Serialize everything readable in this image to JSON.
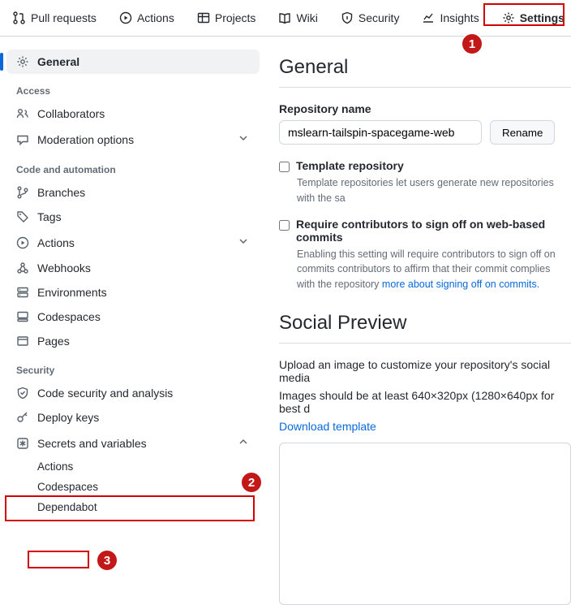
{
  "topnav": [
    {
      "label": "Pull requests",
      "icon": "git-pull-icon"
    },
    {
      "label": "Actions",
      "icon": "play-circle-icon"
    },
    {
      "label": "Projects",
      "icon": "table-icon"
    },
    {
      "label": "Wiki",
      "icon": "book-icon"
    },
    {
      "label": "Security",
      "icon": "shield-icon"
    },
    {
      "label": "Insights",
      "icon": "graph-icon"
    },
    {
      "label": "Settings",
      "icon": "gear-icon"
    }
  ],
  "sidebar": {
    "general": {
      "label": "General"
    },
    "groups": [
      {
        "title": "Access",
        "items": [
          {
            "label": "Collaborators",
            "icon": "people-icon"
          },
          {
            "label": "Moderation options",
            "icon": "comment-icon",
            "expandable": true
          }
        ]
      },
      {
        "title": "Code and automation",
        "items": [
          {
            "label": "Branches",
            "icon": "branch-icon"
          },
          {
            "label": "Tags",
            "icon": "tag-icon"
          },
          {
            "label": "Actions",
            "icon": "play-circle-icon",
            "expandable": true
          },
          {
            "label": "Webhooks",
            "icon": "webhook-icon"
          },
          {
            "label": "Environments",
            "icon": "server-icon"
          },
          {
            "label": "Codespaces",
            "icon": "codespaces-icon"
          },
          {
            "label": "Pages",
            "icon": "browser-icon"
          }
        ]
      },
      {
        "title": "Security",
        "items": [
          {
            "label": "Code security and analysis",
            "icon": "shield-check-icon"
          },
          {
            "label": "Deploy keys",
            "icon": "key-icon"
          },
          {
            "label": "Secrets and variables",
            "icon": "asterisk-icon",
            "expandable": true,
            "expanded": true,
            "subitems": [
              {
                "label": "Actions"
              },
              {
                "label": "Codespaces"
              },
              {
                "label": "Dependabot"
              }
            ]
          }
        ]
      }
    ]
  },
  "content": {
    "general_title": "General",
    "repo_name_label": "Repository name",
    "repo_name_value": "mslearn-tailspin-spacegame-web",
    "rename_btn": "Rename",
    "template_label": "Template repository",
    "template_desc": "Template repositories let users generate new repositories with the sa",
    "signoff_label": "Require contributors to sign off on web-based commits",
    "signoff_desc": "Enabling this setting will require contributors to sign off on commits contributors to affirm that their commit complies with the repository ",
    "signoff_link": "more about signing off on commits.",
    "social_title": "Social Preview",
    "social_desc": "Upload an image to customize your repository's social media",
    "social_dims": "Images should be at least 640×320px (1280×640px for best d",
    "download_template": "Download template"
  },
  "annotations": {
    "b1": "1",
    "b2": "2",
    "b3": "3"
  }
}
